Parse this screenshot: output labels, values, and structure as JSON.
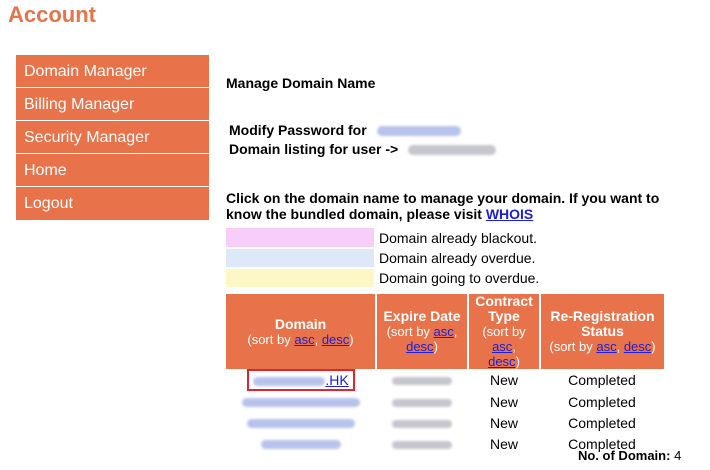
{
  "page_title": "Account",
  "sidebar": {
    "items": [
      "Domain Manager",
      "Billing Manager",
      "Security Manager",
      "Home",
      "Logout"
    ]
  },
  "main": {
    "heading": "Manage Domain Name",
    "modify_password_label": "Modify Password for",
    "domain_listing_label": "Domain listing for user ->",
    "instructions": "Click on the domain name to manage your domain. If you want to know the bundled domain, please visit",
    "whois_link": "WHOIS"
  },
  "legend": [
    {
      "color": "#f7cdf9",
      "text": "Domain already blackout."
    },
    {
      "color": "#dde9f8",
      "text": "Domain already overdue."
    },
    {
      "color": "#fcf7c4",
      "text": "Domain going to overdue."
    }
  ],
  "table": {
    "headers": {
      "domain": "Domain",
      "expire": "Expire Date",
      "contract": "Contract Type",
      "rereg": "Re-Registration Status",
      "sort_by": "(sort by",
      "asc": "asc",
      "desc": "desc",
      "close": ")"
    },
    "rows": [
      {
        "domain_suffix": ".HK",
        "contract": "New",
        "status": "Completed"
      },
      {
        "domain_suffix": "",
        "contract": "New",
        "status": "Completed"
      },
      {
        "domain_suffix": "",
        "contract": "New",
        "status": "Completed"
      },
      {
        "domain_suffix": "",
        "contract": "New",
        "status": "Completed"
      }
    ]
  },
  "count": {
    "label": "No. of Domain:",
    "value": "4"
  },
  "colors": {
    "accent": "#e8734a",
    "link": "#1b1fd8",
    "highlight_border": "#e0252e"
  }
}
